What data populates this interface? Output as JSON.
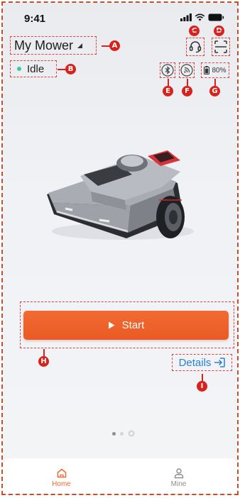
{
  "status_bar": {
    "time": "9:41"
  },
  "header": {
    "device_name": "My Mower",
    "status": "Idle",
    "battery": "80%"
  },
  "main": {
    "start_label": "Start",
    "details_label": "Details"
  },
  "annotations": {
    "a": "A",
    "b": "B",
    "c": "C",
    "d": "D",
    "e": "E",
    "f": "F",
    "g": "G",
    "h": "H",
    "i": "I"
  },
  "tabs": [
    {
      "label": "Home",
      "active": true
    },
    {
      "label": "Mine",
      "active": false
    }
  ],
  "pager": {
    "pages": 3,
    "active": 1
  },
  "colors": {
    "accent": "#ef6a2f",
    "link": "#2b7fd6",
    "status_dot": "#38c9a0",
    "annotation": "#d9221c"
  }
}
